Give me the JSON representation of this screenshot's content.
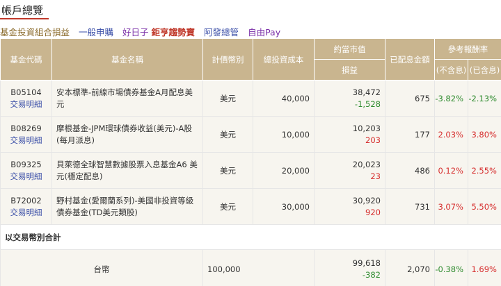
{
  "page": {
    "title": "帳戶總覽"
  },
  "subnav": {
    "items": [
      {
        "label": "基金投資組合損益"
      },
      {
        "label": "一般申購"
      },
      {
        "label_plain": "好日子",
        "label_hot": "鉅亨趨勢寶"
      },
      {
        "label": "阿發總管"
      },
      {
        "label": "自由Pay"
      }
    ]
  },
  "table": {
    "headers": {
      "code": "基金代碼",
      "name": "基金名稱",
      "currency": "計價幣別",
      "cost": "總投資成本",
      "market_value": "約當市值",
      "pnl": "損益",
      "dividend": "已配息金額",
      "ref_return": "參考報酬率",
      "excl_div": "(不含息)",
      "incl_div": "(已含息)"
    },
    "rows": [
      {
        "code": "B05104",
        "detail": "交易明細",
        "name": "安本標準-前線市場債券基金A月配息美元",
        "currency": "美元",
        "cost": "40,000",
        "market_value": "38,472",
        "pnl": "-1,528",
        "dividend": "675",
        "ret_excl": "-3.82%",
        "ret_incl": "-2.13%"
      },
      {
        "code": "B08269",
        "detail": "交易明細",
        "name": "摩根基金-JPM環球債券收益(美元)-A股(每月派息)",
        "currency": "美元",
        "cost": "10,000",
        "market_value": "10,203",
        "pnl": "203",
        "dividend": "177",
        "ret_excl": "2.03%",
        "ret_incl": "3.80%"
      },
      {
        "code": "B09325",
        "detail": "交易明細",
        "name": "貝萊德全球智慧數據股票入息基金A6 美元(穩定配息)",
        "currency": "美元",
        "cost": "20,000",
        "market_value": "20,023",
        "pnl": "23",
        "dividend": "486",
        "ret_excl": "0.12%",
        "ret_incl": "2.55%"
      },
      {
        "code": "B72002",
        "detail": "交易明細",
        "name": "野村基金(愛爾蘭系列)-美國非投資等級債券基金(TD美元類股)",
        "currency": "美元",
        "cost": "30,000",
        "market_value": "30,920",
        "pnl": "920",
        "dividend": "731",
        "ret_excl": "3.07%",
        "ret_incl": "5.50%"
      }
    ],
    "section_label": "以交易幣別合計",
    "total": {
      "currency": "台幣",
      "cost": "100,000",
      "market_value": "99,618",
      "pnl": "-382",
      "dividend": "2,070",
      "ret_excl": "-0.38%",
      "ret_incl": "1.69%"
    }
  },
  "colors": {
    "header_bg": "#c9b58f",
    "negative": "#2e8b2e",
    "positive": "#d62d2d",
    "link": "#3b4fa8",
    "title_underline": "#c0392b"
  }
}
